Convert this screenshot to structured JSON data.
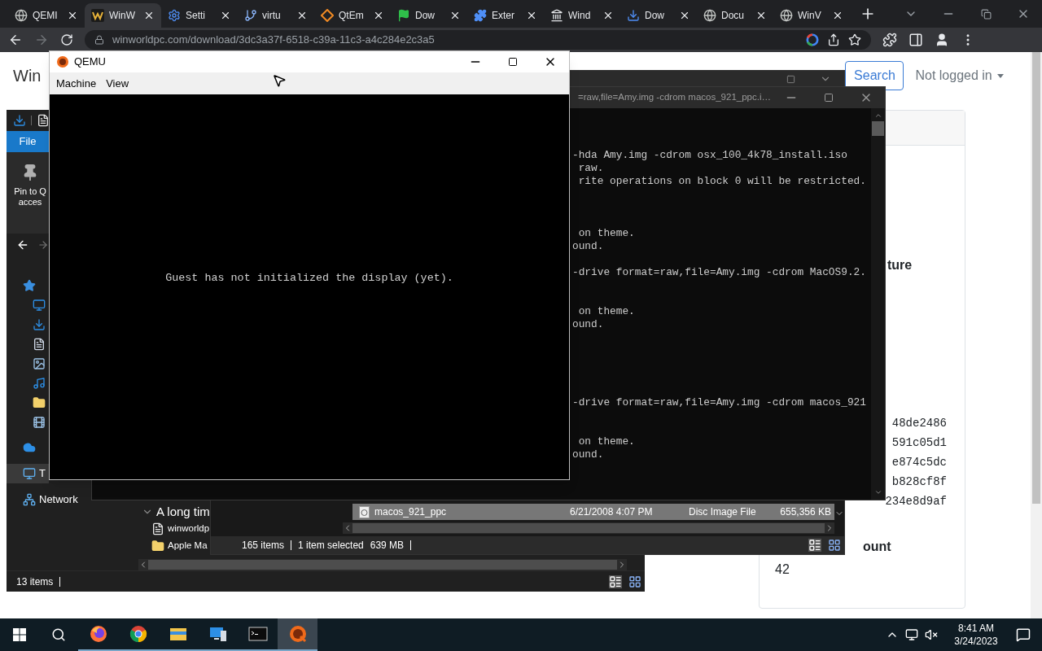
{
  "browser": {
    "tabs": [
      {
        "label": "QEMI",
        "kind": "globe",
        "selected": false
      },
      {
        "label": "WinW",
        "kind": "w-logo",
        "selected": true
      },
      {
        "label": "Setti",
        "kind": "gear",
        "selected": false
      },
      {
        "label": "virtu",
        "kind": "branch",
        "selected": false
      },
      {
        "label": "QtEm",
        "kind": "diamond",
        "selected": false
      },
      {
        "label": "Dow",
        "kind": "flag",
        "selected": false
      },
      {
        "label": "Exter",
        "kind": "puzzle",
        "selected": false
      },
      {
        "label": "Wind",
        "kind": "bank",
        "selected": false
      },
      {
        "label": "Dow",
        "kind": "download",
        "selected": false
      },
      {
        "label": "Docu",
        "kind": "globe",
        "selected": false
      },
      {
        "label": "WinV",
        "kind": "globe",
        "selected": false
      }
    ],
    "url": "winworldpc.com/download/3dc3a37f-6518-c39a-11c3-a4c284e2c3a5",
    "page": {
      "site_title": "Win",
      "search_button": "Search",
      "account_menu": "Not logged in",
      "card": {
        "heading": "ture",
        "hashes": [
          "48de2486",
          "591c05d1",
          "e874c5dc",
          "b828cf8f",
          "234e8d9af"
        ],
        "count_label": "ount",
        "count_value": "42"
      }
    }
  },
  "explorer_back": {
    "ribbon_tab": "File",
    "ribbon_button": [
      "Pin to Q",
      "acces"
    ],
    "nav_items": [
      {
        "kind": "quick",
        "selected": false,
        "children": [
          {
            "kind": "desktop",
            "selected": false
          },
          {
            "kind": "downloads",
            "selected": false
          },
          {
            "kind": "documents",
            "selected": false
          },
          {
            "kind": "pictures",
            "selected": false
          },
          {
            "kind": "music",
            "selected": false
          },
          {
            "kind": "folder",
            "selected": false
          },
          {
            "kind": "videos",
            "selected": false
          }
        ]
      },
      {
        "kind": "cloud",
        "selected": false
      },
      {
        "kind": "pc",
        "label": "T",
        "selected": true
      },
      {
        "kind": "network",
        "label": "Network",
        "selected": false
      }
    ],
    "group_header": "A long tim",
    "files": [
      {
        "kind": "document",
        "name": "winworldp"
      },
      {
        "kind": "folder",
        "name": "Apple Ma"
      }
    ],
    "status": "13 items"
  },
  "explorer_front": {
    "file": {
      "name": "macos_921_ppc",
      "date": "6/21/2008 4:07 PM",
      "type": "Disc Image File",
      "size": "655,356 KB",
      "selected": true
    },
    "status": {
      "count": "165 items",
      "selection": "1 item selected",
      "size": "639 MB"
    }
  },
  "terminal": {
    "title": "=raw,file=Amy.img -cdrom macos_921_ppc.i…",
    "lines": [
      {
        "kind": "blank"
      },
      {
        "kind": "blank"
      },
      {
        "kind": "blank"
      },
      {
        "kind": "text",
        "text": "-hda Amy.img -cdrom osx_100_4k78_install.iso"
      },
      {
        "kind": "text",
        "text": " raw."
      },
      {
        "kind": "text",
        "text": " rite operations on block 0 will be restricted."
      },
      {
        "kind": "blank"
      },
      {
        "kind": "blank"
      },
      {
        "kind": "blank"
      },
      {
        "kind": "text",
        "text": " on theme."
      },
      {
        "kind": "text",
        "text": "ound."
      },
      {
        "kind": "blank"
      },
      {
        "kind": "text",
        "text": "-drive format=raw,file=Amy.img -cdrom MacOS9.2."
      },
      {
        "kind": "blank"
      },
      {
        "kind": "blank"
      },
      {
        "kind": "text",
        "text": " on theme."
      },
      {
        "kind": "text",
        "text": "ound."
      },
      {
        "kind": "blank"
      },
      {
        "kind": "blank"
      },
      {
        "kind": "blank"
      },
      {
        "kind": "blank"
      },
      {
        "kind": "blank"
      },
      {
        "kind": "text",
        "text": "-drive format=raw,file=Amy.img -cdrom macos_921"
      },
      {
        "kind": "blank"
      },
      {
        "kind": "blank"
      },
      {
        "kind": "text",
        "text": " on theme."
      },
      {
        "kind": "text",
        "text": "ound."
      }
    ]
  },
  "qemu": {
    "title": "QEMU",
    "menus": [
      "Machine",
      "View"
    ],
    "message": "Guest has not initialized the display (yet)."
  },
  "taskbar": {
    "apps": [
      {
        "kind": "firefox",
        "active": false
      },
      {
        "kind": "chrome",
        "active": false
      },
      {
        "kind": "explorer",
        "active": false
      },
      {
        "kind": "remote",
        "active": false
      },
      {
        "kind": "terminal",
        "active": false
      },
      {
        "kind": "qemu",
        "active": true
      }
    ],
    "time": "8:41 AM",
    "date": "3/24/2023"
  }
}
